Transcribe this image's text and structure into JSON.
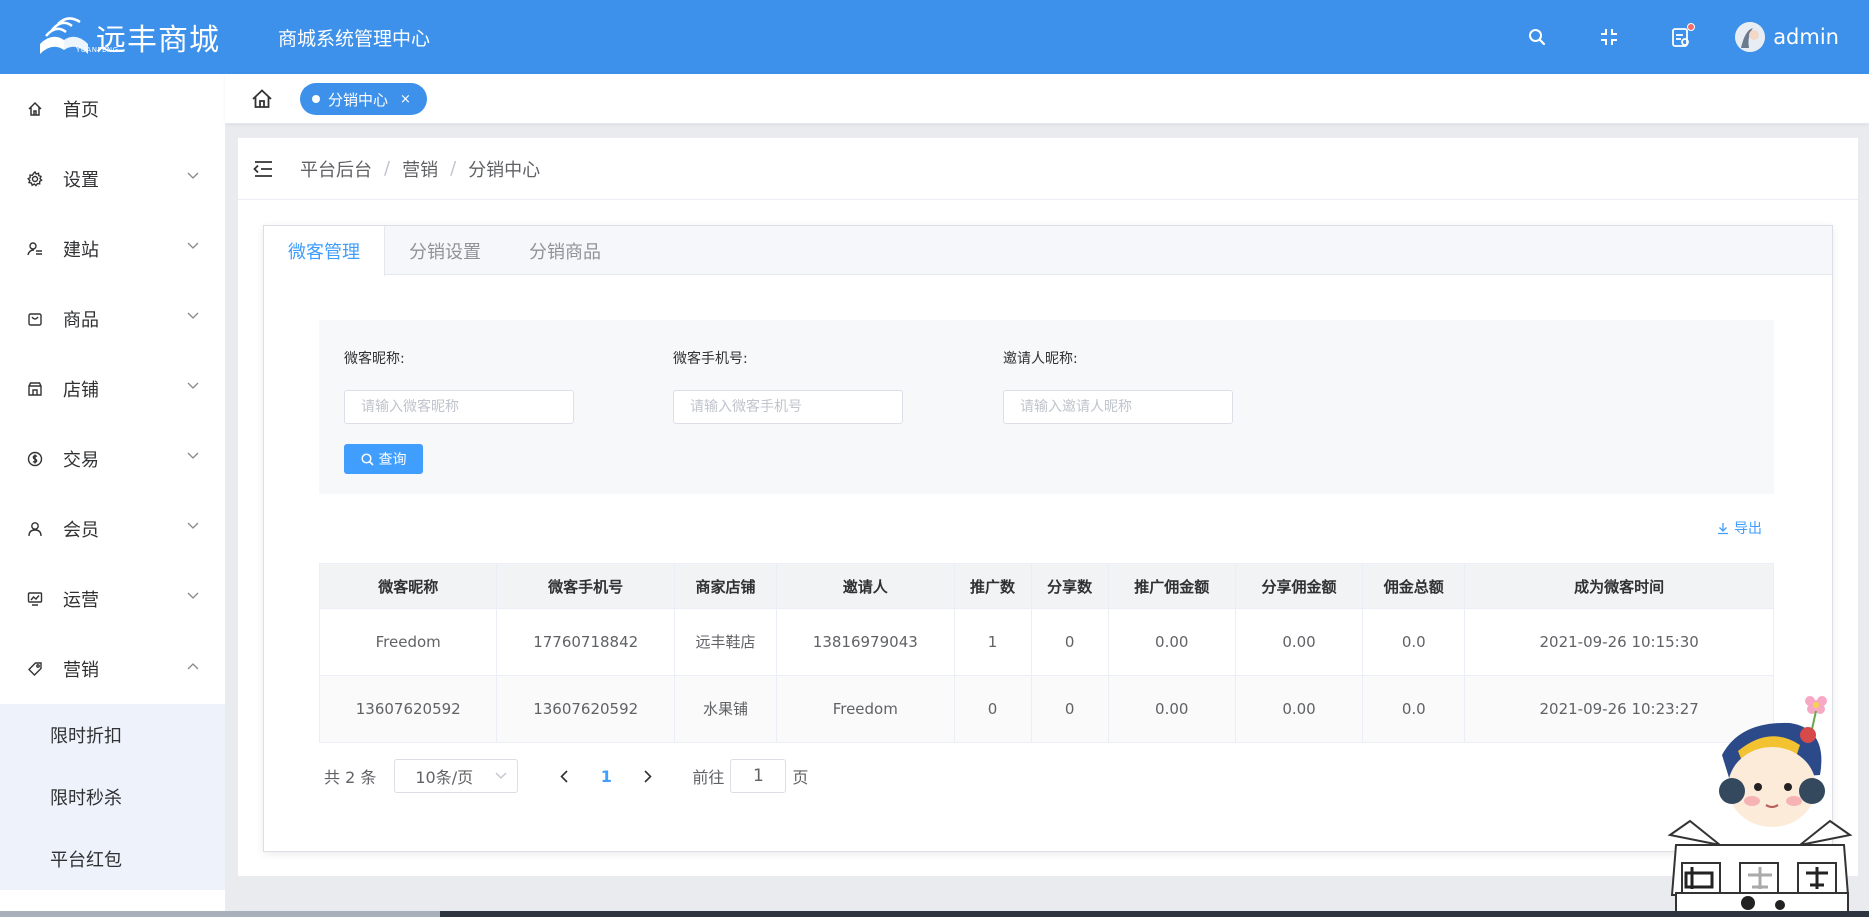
{
  "header": {
    "logo_text": "远丰商城",
    "logo_sub": "YUANFENG",
    "app_title": "商城系统管理中心",
    "user_name": "admin"
  },
  "sidebar": {
    "items": [
      {
        "label": "首页",
        "icon": "home-icon"
      },
      {
        "label": "设置",
        "icon": "gear-icon"
      },
      {
        "label": "建站",
        "icon": "site-icon"
      },
      {
        "label": "商品",
        "icon": "goods-icon"
      },
      {
        "label": "店铺",
        "icon": "store-icon"
      },
      {
        "label": "交易",
        "icon": "trade-icon"
      },
      {
        "label": "会员",
        "icon": "member-icon"
      },
      {
        "label": "运营",
        "icon": "operation-icon"
      },
      {
        "label": "营销",
        "icon": "tag-icon"
      }
    ],
    "marketing_sub": [
      "限时折扣",
      "限时秒杀",
      "平台红包"
    ]
  },
  "tabs": {
    "open_tab": "分销中心",
    "close_glyph": "×"
  },
  "breadcrumb": [
    "平台后台",
    "营销",
    "分销中心"
  ],
  "breadcrumb_sep": "/",
  "card_tabs": [
    "微客管理",
    "分销设置",
    "分销商品"
  ],
  "filters": {
    "nickname_label": "微客昵称:",
    "nickname_placeholder": "请输入微客昵称",
    "phone_label": "微客手机号:",
    "phone_placeholder": "请输入微客手机号",
    "inviter_label": "邀请人昵称:",
    "inviter_placeholder": "请输入邀请人昵称",
    "search_button": "查询"
  },
  "export_label": "导出",
  "table": {
    "columns": [
      "微客昵称",
      "微客手机号",
      "商家店铺",
      "邀请人",
      "推广数",
      "分享数",
      "推广佣金额",
      "分享佣金额",
      "佣金总额",
      "成为微客时间"
    ],
    "rows": [
      [
        "Freedom",
        "17760718842",
        "远丰鞋店",
        "13816979043",
        "1",
        "0",
        "0.00",
        "0.00",
        "0.0",
        "2021-09-26 10:15:30"
      ],
      [
        "13607620592",
        "13607620592",
        "水果铺",
        "Freedom",
        "0",
        "0",
        "0.00",
        "0.00",
        "0.0",
        "2021-09-26 10:23:27"
      ]
    ]
  },
  "pagination": {
    "total": "共 2 条",
    "page_size": "10条/页",
    "current_page": "1",
    "goto_prefix": "前往",
    "goto_value": "1",
    "goto_suffix": "页"
  },
  "colors": {
    "header": "#3d91ea",
    "accent": "#409eff",
    "submenu_bg": "#eef3fb"
  }
}
